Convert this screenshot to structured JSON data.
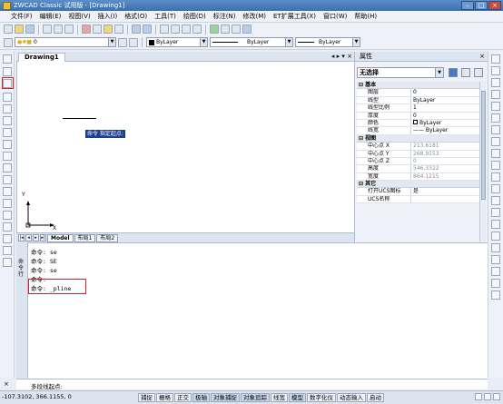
{
  "app": {
    "title": "ZWCAD Classic 试用版 - [Drawing1]"
  },
  "menu": [
    "文件(F)",
    "编辑(E)",
    "视图(V)",
    "插入(I)",
    "格式(O)",
    "工具(T)",
    "绘图(D)",
    "标注(N)",
    "修改(M)",
    "ET扩展工具(X)",
    "窗口(W)",
    "帮助(H)"
  ],
  "toolbar2": {
    "layer_value": "0",
    "color_value": "ByLayer",
    "linetype_value": "ByLayer",
    "lineweight_value": "ByLayer"
  },
  "drawing": {
    "tab": "Drawing1",
    "tip": "命令 指定起点:",
    "axis_x": "X",
    "axis_y": "Y"
  },
  "layout_tabs": [
    "Model",
    "布局1",
    "布局2"
  ],
  "properties": {
    "title": "属性",
    "selection": "无选择",
    "sections": [
      {
        "name": "基本",
        "rows": [
          {
            "k": "图层",
            "v": "0",
            "grey": false
          },
          {
            "k": "线型",
            "v": "ByLayer",
            "grey": false
          },
          {
            "k": "线型比例",
            "v": "1",
            "grey": false
          },
          {
            "k": "厚度",
            "v": "0",
            "grey": false
          },
          {
            "k": "颜色",
            "v": "ByLayer",
            "grey": false
          },
          {
            "k": "线宽",
            "v": "—— ByLayer",
            "grey": false
          }
        ]
      },
      {
        "name": "视图",
        "rows": [
          {
            "k": "中心点 X",
            "v": "213.6181",
            "grey": true
          },
          {
            "k": "中心点 Y",
            "v": "268.9153",
            "grey": true
          },
          {
            "k": "中心点 Z",
            "v": "0",
            "grey": true
          },
          {
            "k": "高度",
            "v": "546.3322",
            "grey": true
          },
          {
            "k": "宽度",
            "v": "864.1215",
            "grey": true
          }
        ]
      },
      {
        "name": "其它",
        "rows": [
          {
            "k": "打开UCS图标",
            "v": "是",
            "grey": false
          },
          {
            "k": "UCS名称",
            "v": "",
            "grey": false
          }
        ]
      }
    ]
  },
  "command": {
    "side_label": "命令行",
    "lines": [
      "命令: se",
      "命令: SE",
      "命令: se",
      "命令:",
      "命令: _pline"
    ],
    "prompt": "多段线起点:"
  },
  "status": {
    "coords": "-107.3102, 366.1155, 0",
    "buttons": [
      "捕捉",
      "栅格",
      "正交",
      "极轴",
      "对象捕捉",
      "对象追踪",
      "线宽",
      "模型",
      "数字化仪",
      "动态输入",
      "启动"
    ],
    "active": [
      "极轴",
      "对象捕捉",
      "对象追踪",
      "模型"
    ]
  }
}
